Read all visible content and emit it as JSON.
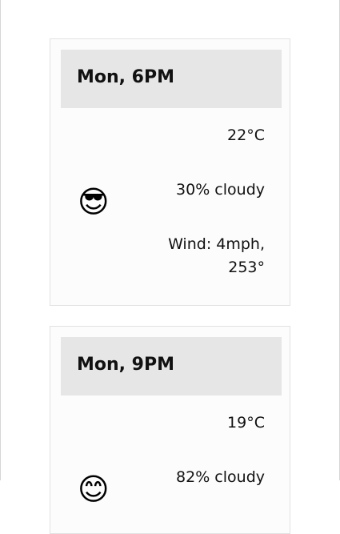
{
  "forecasts": [
    {
      "time": "Mon, 6PM",
      "temperature": "22°C",
      "clouds": "30% cloudy",
      "wind": "Wind: 4mph, 253°",
      "icon": "smiling-face-with-sunglasses-icon"
    },
    {
      "time": "Mon, 9PM",
      "temperature": "19°C",
      "clouds": "82% cloudy",
      "icon": "smiling-face-icon"
    }
  ]
}
